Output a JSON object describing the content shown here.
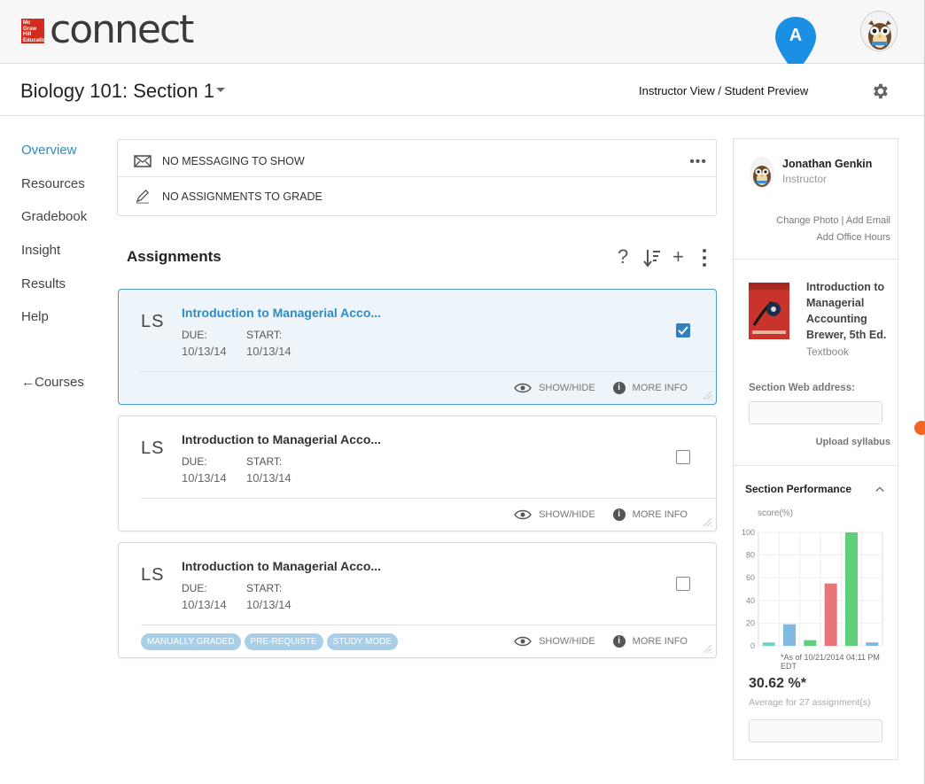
{
  "header": {
    "logo_box_text": "Mc Graw Hill Education",
    "logo_text": "connect",
    "pin_letter": "A"
  },
  "course": {
    "title": "Biology 101: Section 1",
    "view_label": "Instructor View / Student Preview"
  },
  "nav": {
    "items": [
      {
        "label": "Overview",
        "active": true
      },
      {
        "label": "Resources"
      },
      {
        "label": "Gradebook"
      },
      {
        "label": "Insight"
      },
      {
        "label": "Results"
      },
      {
        "label": "Help"
      }
    ],
    "courses_label": "Courses"
  },
  "messages": {
    "messaging": "NO MESSAGING TO SHOW",
    "grading": "NO ASSIGNMENTS TO GRADE",
    "more": "•••"
  },
  "assignments": {
    "heading": "Assignments",
    "tools": {
      "help": "?",
      "add": "+"
    },
    "cards": [
      {
        "type": "LS",
        "title": "Introduction to Managerial Acco...",
        "due_label": "DUE:",
        "start_label": "START:",
        "due": "10/13/14",
        "start": "10/13/14",
        "checked": true,
        "selected": true,
        "show_hide": "SHOW/HIDE",
        "more_info": "MORE INFO",
        "tags": []
      },
      {
        "type": "LS",
        "title": "Introduction to Managerial Acco...",
        "due_label": "DUE:",
        "start_label": "START:",
        "due": "10/13/14",
        "start": "10/13/14",
        "checked": false,
        "selected": false,
        "show_hide": "SHOW/HIDE",
        "more_info": "MORE INFO",
        "tags": []
      },
      {
        "type": "LS",
        "title": "Introduction to Managerial Acco...",
        "due_label": "DUE:",
        "start_label": "START:",
        "due": "10/13/14",
        "start": "10/13/14",
        "checked": false,
        "selected": false,
        "show_hide": "SHOW/HIDE",
        "more_info": "MORE INFO",
        "tags": [
          "MANUALLY GRADED",
          "PRE-REQUISTE",
          "STUDY MODE"
        ]
      }
    ]
  },
  "instructor": {
    "name": "Jonathan Genkin",
    "role": "Instructor",
    "change_photo": "Change Photo",
    "add_email": "Add Email",
    "add_office_hours": "Add Office Hours"
  },
  "textbook": {
    "title": "Introduction to Managerial Accounting Brewer, 5th Ed.",
    "type": "Textbook"
  },
  "section": {
    "web_address_label": "Section Web address:",
    "upload_syllabus": "Upload syllabus",
    "performance_title": "Section Performance",
    "as_of": "*As of 10/21/2014 04:11 PM EDT",
    "average_value": "30.62 %*",
    "average_label": "Average for 27 assignment(s)"
  },
  "colors": {
    "accent": "#2e8bc9",
    "pin": "#1a8fe3",
    "bar_blue": "#7fb8e0",
    "bar_teal": "#6fd0d0",
    "bar_green": "#5fd07a",
    "bar_red": "#e9757a"
  },
  "chart_data": {
    "type": "bar",
    "ylabel": "score(%)",
    "ylim": [
      0,
      100
    ],
    "yticks": [
      0,
      20,
      40,
      60,
      80,
      100
    ],
    "values": [
      3,
      19,
      5,
      55,
      100,
      3
    ],
    "colors": [
      "#6fd0d0",
      "#7fb8e0",
      "#5fd07a",
      "#e9757a",
      "#5fd07a",
      "#7fb8e0"
    ]
  }
}
